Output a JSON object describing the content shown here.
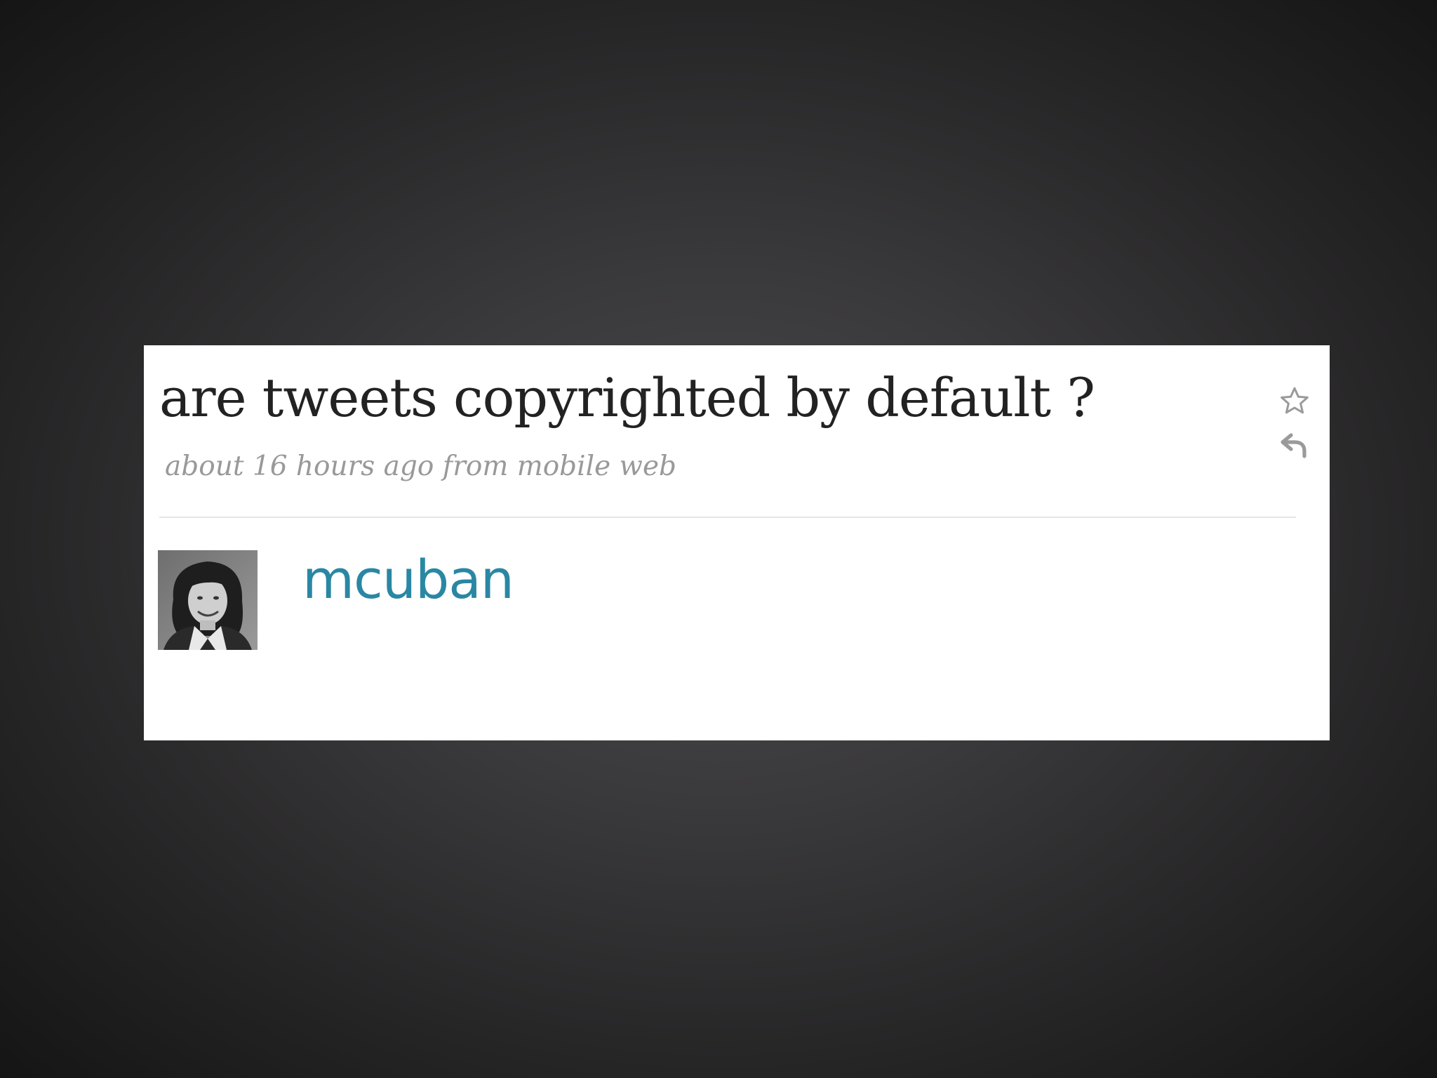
{
  "tweet": {
    "text": "are tweets copyrighted by default ?",
    "meta": "about 16 hours ago from mobile web",
    "author": {
      "screen_name": "mcuban",
      "avatar_icon": "profile-photo"
    },
    "actions": [
      {
        "icon": "star-icon",
        "label": "favorite"
      },
      {
        "icon": "reply-icon",
        "label": "reply"
      }
    ]
  },
  "colors": {
    "background": "#2f2e30",
    "card": "#ffffff",
    "tweet_text": "#222222",
    "meta_text": "#999999",
    "screen_name": "#2a87a3",
    "divider": "#e3e6ec"
  }
}
